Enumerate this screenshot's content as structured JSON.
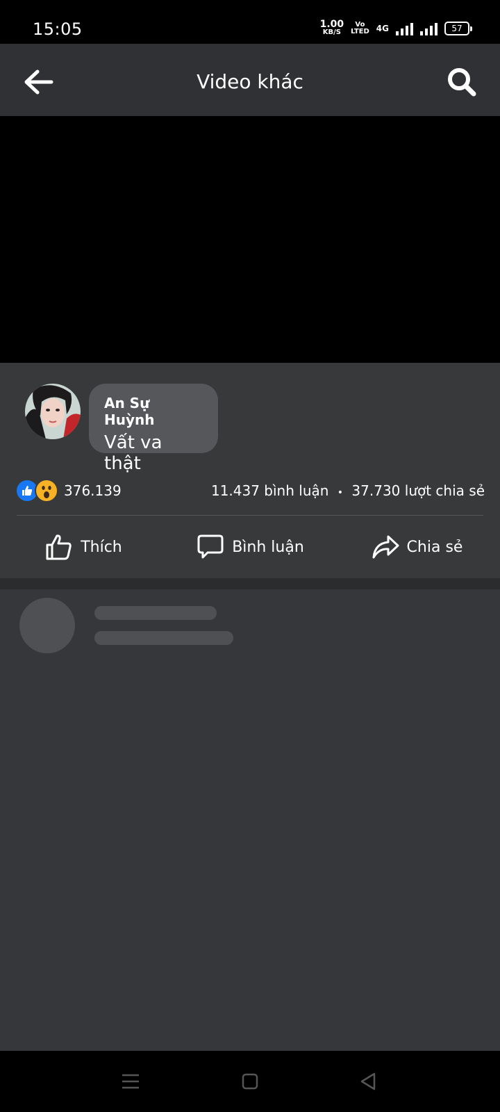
{
  "status_bar": {
    "time": "15:05",
    "net_speed_value": "1.00",
    "net_speed_unit": "KB/S",
    "volte_top": "Vo",
    "volte_bottom": "LTED",
    "network": "4G",
    "battery": "57"
  },
  "header": {
    "title": "Video khác",
    "back_icon": "arrow-left-icon",
    "search_icon": "search-icon"
  },
  "post": {
    "comment_author": "An Sự Huỳnh",
    "comment_text": "Vất va thật",
    "reactions": [
      "like",
      "wow"
    ],
    "reaction_count": "376.139",
    "comments_count_text": "11.437 bình luận",
    "separator": "•",
    "shares_count_text": "37.730 lượt chia sẻ"
  },
  "actions": {
    "like_label": "Thích",
    "comment_label": "Bình luận",
    "share_label": "Chia sẻ"
  },
  "colors": {
    "app_bar": "#303134",
    "post_bg": "#38393b",
    "bubble_bg": "#55575b",
    "like_blue": "#1877f2",
    "wow_yellow": "#f7b125"
  }
}
